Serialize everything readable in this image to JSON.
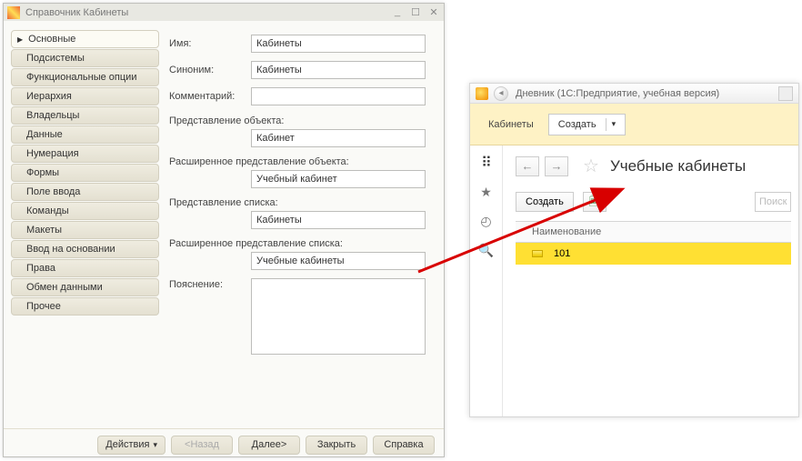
{
  "designer": {
    "title": "Справочник Кабинеты",
    "nav": [
      "Основные",
      "Подсистемы",
      "Функциональные опции",
      "Иерархия",
      "Владельцы",
      "Данные",
      "Нумерация",
      "Формы",
      "Поле ввода",
      "Команды",
      "Макеты",
      "Ввод на основании",
      "Права",
      "Обмен данными",
      "Прочее"
    ],
    "active_nav_index": 0,
    "fields": {
      "name_label": "Имя:",
      "name_value": "Кабинеты",
      "syn_label": "Синоним:",
      "syn_value": "Кабинеты",
      "comm_label": "Комментарий:",
      "comm_value": "",
      "objrep_label": "Представление объекта:",
      "objrep_value": "Кабинет",
      "extobj_label": "Расширенное представление объекта:",
      "extobj_value": "Учебный кабинет",
      "listrep_label": "Представление списка:",
      "listrep_value": "Кабинеты",
      "extlist_label": "Расширенное представление списка:",
      "extlist_value": "Учебные кабинеты",
      "expl_label": "Пояснение:",
      "expl_value": ""
    },
    "footer": {
      "actions": "Действия",
      "back": "<Назад",
      "next": "Далее>",
      "close": "Закрыть",
      "help": "Справка"
    }
  },
  "enterprise": {
    "title": "Дневник  (1С:Предприятие, учебная версия)",
    "tab": "Кабинеты",
    "create": "Создать",
    "page_heading": "Учебные кабинеты",
    "list_create": "Создать",
    "search_placeholder": "Поиск",
    "grid_header": "Наименование",
    "row_value": "101"
  }
}
